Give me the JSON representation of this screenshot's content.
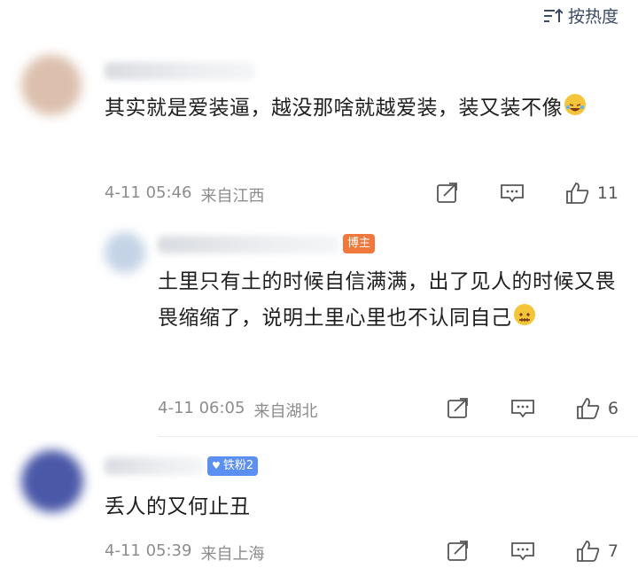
{
  "sort": {
    "label": "按热度",
    "icon": "sort-lines-icon"
  },
  "comments": [
    {
      "avatar_color": "#d9b9a4",
      "text": "其实就是爱装逼，越没那啥就越爱装，装又装不像",
      "emoji": "laughing-tears-emoji",
      "time": "4-11 05:46",
      "location": "来自江西",
      "likes": "11"
    },
    {
      "avatar_color": "#b9cbe0",
      "badge": "博主",
      "badge_color": "#f0783c",
      "text": "土里只有土的时候自信满满，出了见人的时候又畏畏缩缩了，说明土里心里也不认同自己",
      "emoji": "zipper-mouth-emoji",
      "time": "4-11 06:05",
      "location": "来自湖北",
      "likes": "6"
    },
    {
      "avatar_color": "#4a58a8",
      "badge": "铁粉2",
      "badge_color": "#5b8ff0",
      "text": "丢人的又何止丑",
      "time": "4-11 05:39",
      "location": "来自上海",
      "likes": "7"
    }
  ],
  "icons": {
    "share": "share-icon",
    "reply": "comment-icon",
    "like": "thumbs-up-icon"
  }
}
